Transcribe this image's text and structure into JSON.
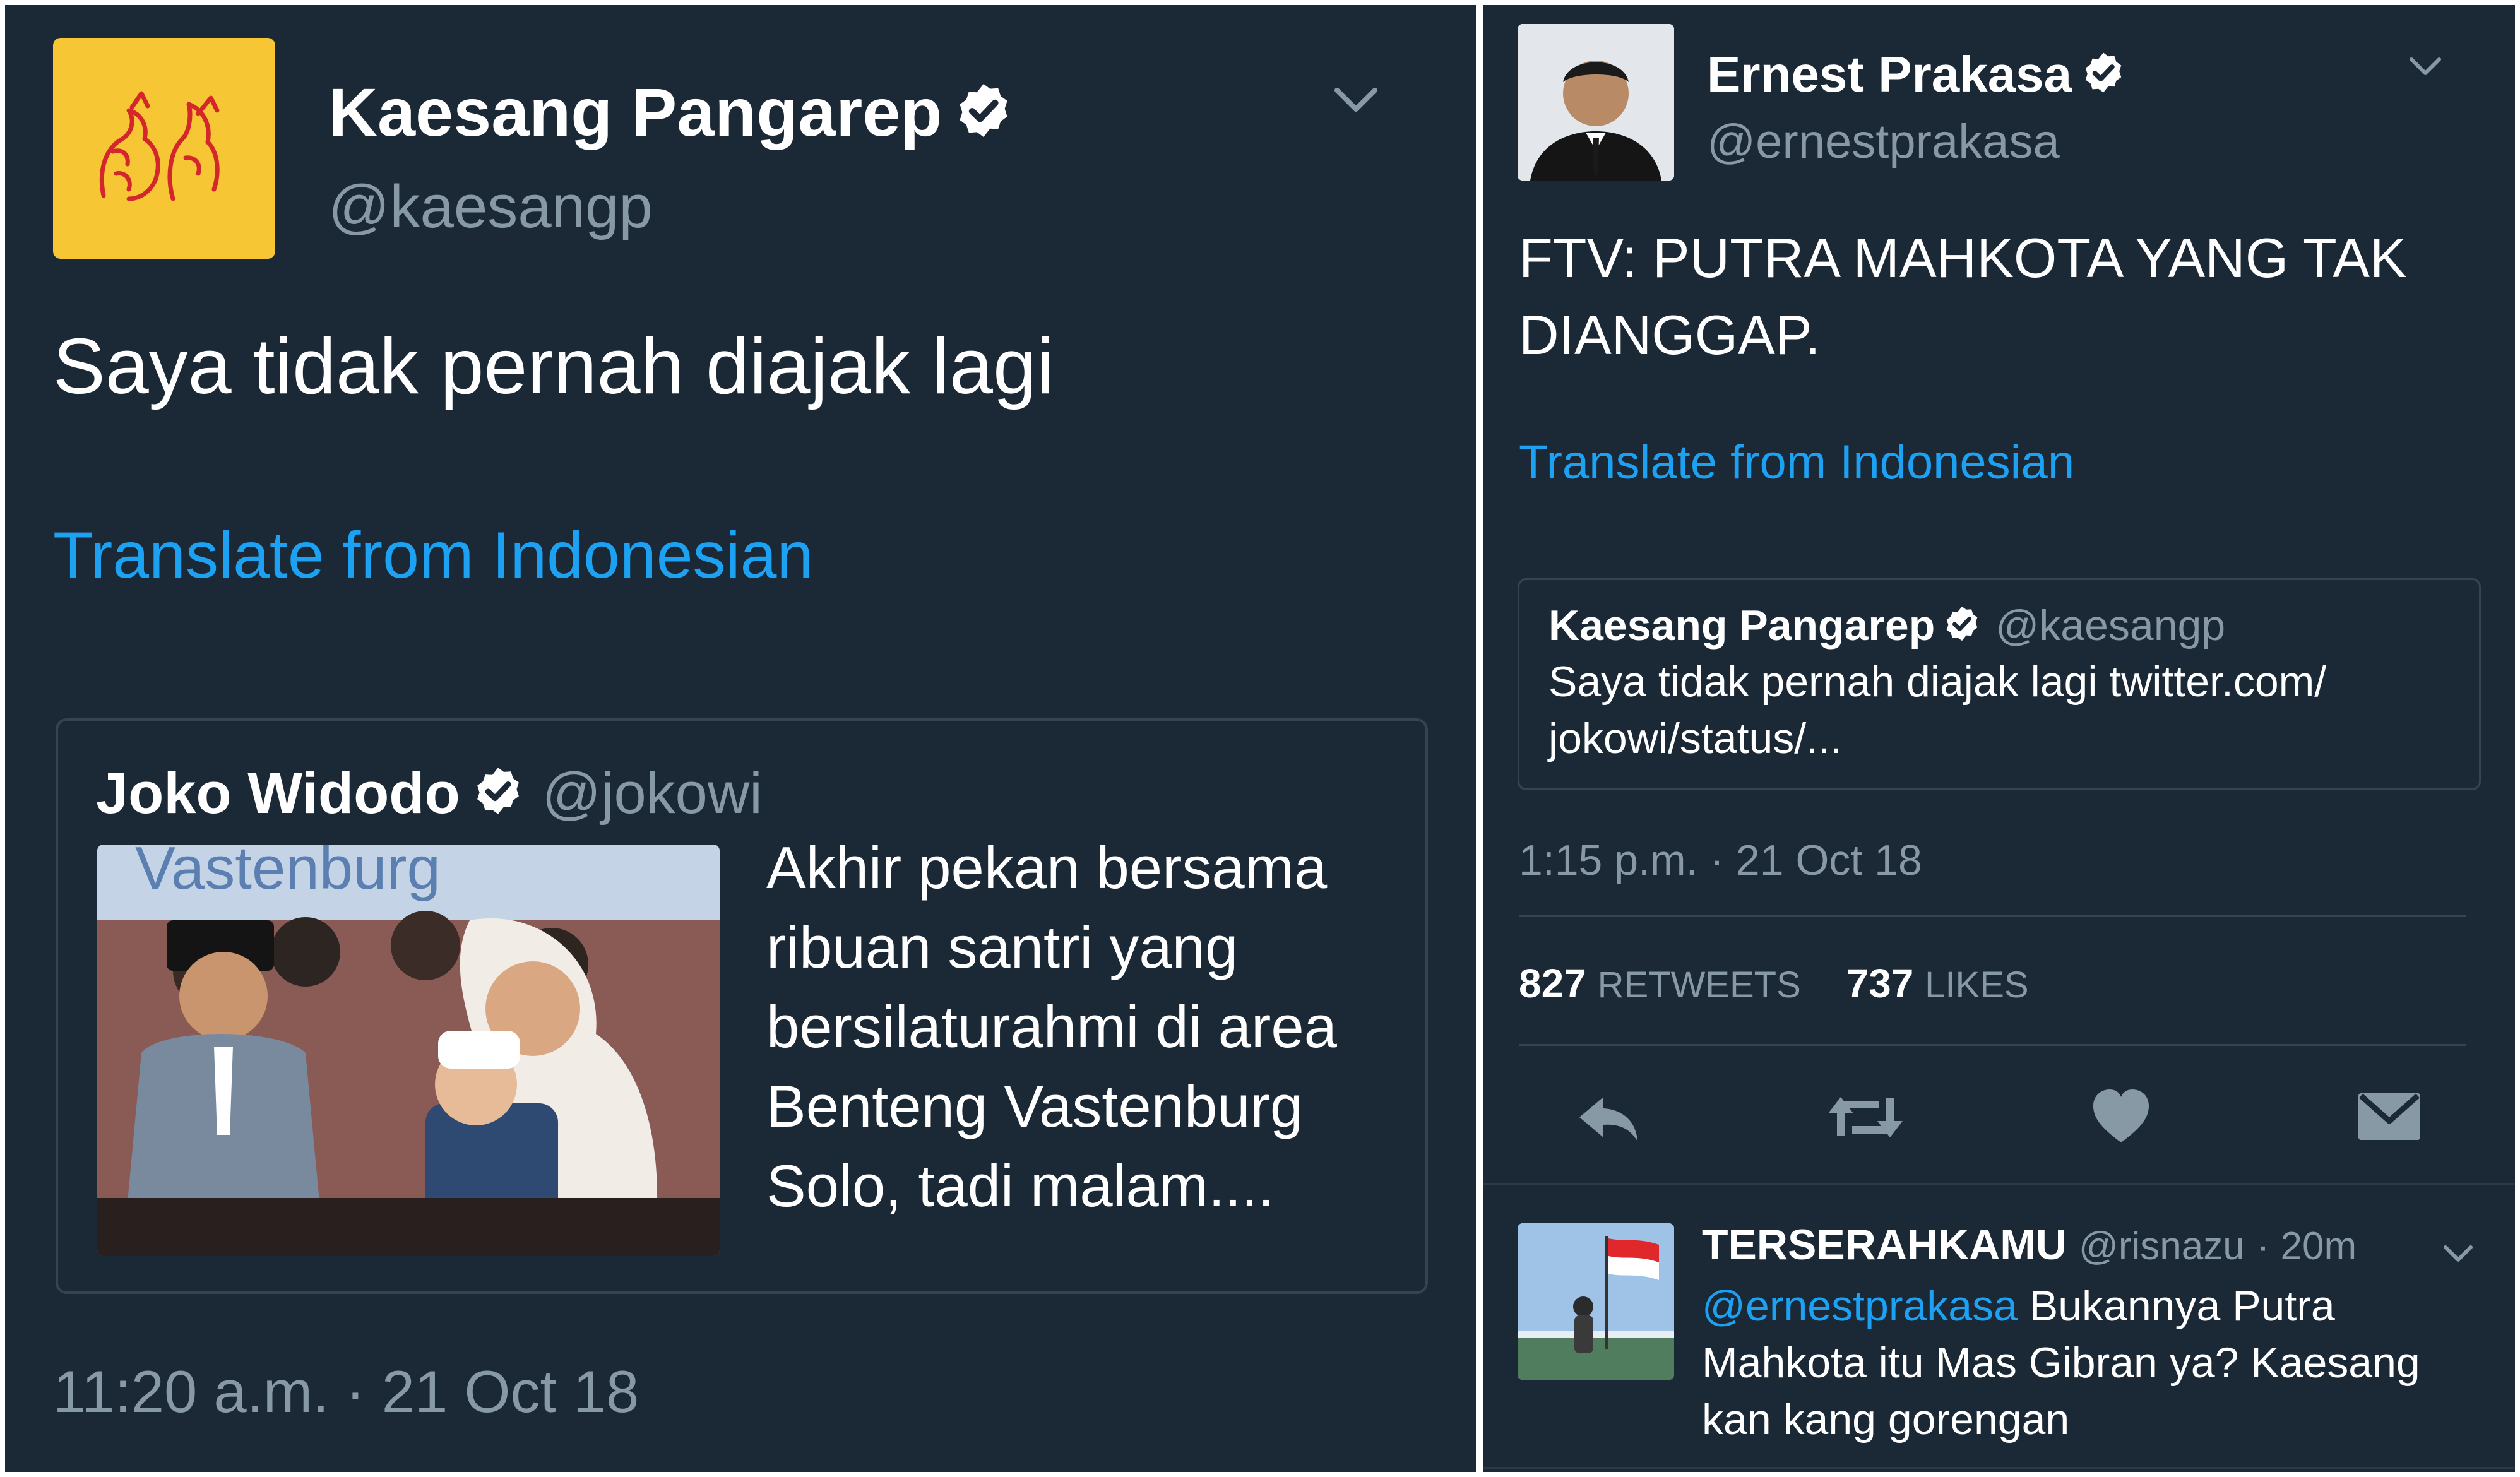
{
  "left_tweet": {
    "author_name": "Kaesang Pangarep",
    "author_handle": "@kaesangp",
    "text": "Saya tidak pernah diajak lagi",
    "translate_label": "Translate from Indonesian",
    "quoted": {
      "author_name": "Joko Widodo",
      "author_handle": "@jokowi",
      "text_lines": [
        "Akhir pekan bersama",
        "ribuan santri yang",
        "bersilaturahmi di area",
        "Benteng Vastenburg",
        "Solo, tadi malam...."
      ],
      "image_caption": "Vastenburg"
    },
    "timestamp": "11:20 a.m. · 21 Oct 18"
  },
  "right_tweet": {
    "author_name": "Ernest Prakasa",
    "author_handle": "@ernestprakasa",
    "text": "FTV: PUTRA MAHKOTA YANG TAK DIANGGAP.",
    "translate_label": "Translate from Indonesian",
    "quoted": {
      "author_name": "Kaesang Pangarep",
      "author_handle": "@kaesangp",
      "text": "Saya tidak pernah diajak lagi twitter.com/ jokowi/status/..."
    },
    "timestamp": "1:15 p.m. · 21 Oct 18",
    "stats": {
      "retweets_count": "827",
      "retweets_label": "RETWEETS",
      "likes_count": "737",
      "likes_label": "LIKES"
    },
    "actions": [
      "reply-icon",
      "retweet-icon",
      "like-icon",
      "message-icon"
    ]
  },
  "reply": {
    "author_name": "TERSERAHKAMU",
    "author_handle": "@risnazu",
    "time": "· 20m",
    "mention": "@ernestprakasa",
    "text": "Bukannya Putra Mahkota itu Mas Gibran ya? Kaesang kan kang gorengan"
  },
  "colors": {
    "background": "#1b2836",
    "accent": "#1da1f2",
    "secondary_text": "#8899a6",
    "border": "#38444d",
    "logo_yellow": "#f6c635",
    "logo_red": "#d3272b"
  }
}
